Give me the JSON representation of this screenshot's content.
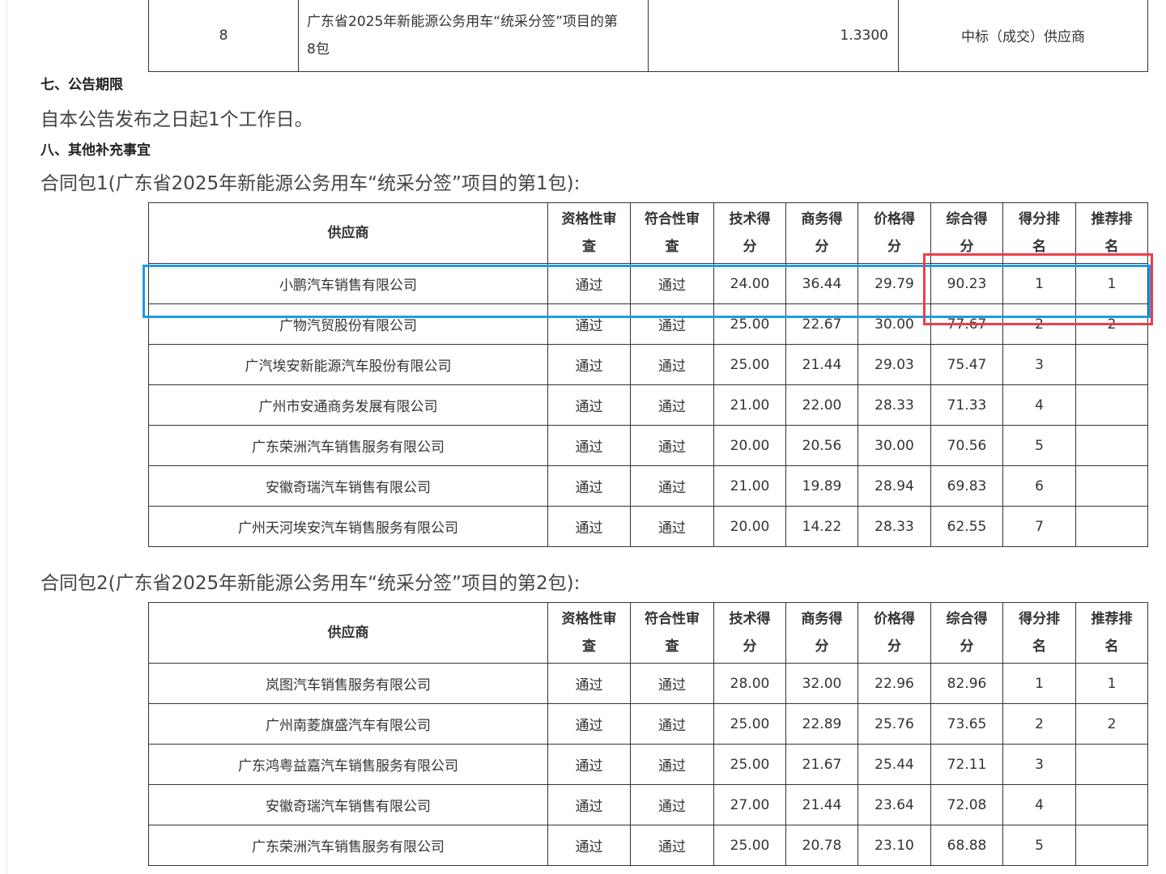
{
  "top_table": {
    "row": {
      "index": "8",
      "package_line1": "广东省2025年新能源公务用车“统采分签”项目的第",
      "package_line2": "8包",
      "amount": "1.3300",
      "result": "中标（成交）供应商"
    }
  },
  "section7": {
    "heading": "七、公告期限",
    "text": "自本公告发布之日起1个工作日。"
  },
  "section8": {
    "heading": "八、其他补充事宜"
  },
  "headers": {
    "supplier": "供应商",
    "qualification_1": "资格性审",
    "qualification_2": "查",
    "compliance_1": "符合性审",
    "compliance_2": "查",
    "tech_1": "技术得",
    "tech_2": "分",
    "business_1": "商务得",
    "business_2": "分",
    "price_1": "价格得",
    "price_2": "分",
    "total_1": "综合得",
    "total_2": "分",
    "rank_1": "得分排",
    "rank_2": "名",
    "rec_1": "推荐排",
    "rec_2": "名"
  },
  "package1": {
    "caption": "合同包1(广东省2025年新能源公务用车“统采分签”项目的第1包):",
    "rows": [
      [
        "小鹏汽车销售有限公司",
        "通过",
        "通过",
        "24.00",
        "36.44",
        "29.79",
        "90.23",
        "1",
        "1"
      ],
      [
        "广物汽贸股份有限公司",
        "通过",
        "通过",
        "25.00",
        "22.67",
        "30.00",
        "77.67",
        "2",
        "2"
      ],
      [
        "广汽埃安新能源汽车股份有限公司",
        "通过",
        "通过",
        "25.00",
        "21.44",
        "29.03",
        "75.47",
        "3",
        ""
      ],
      [
        "广州市安通商务发展有限公司",
        "通过",
        "通过",
        "21.00",
        "22.00",
        "28.33",
        "71.33",
        "4",
        ""
      ],
      [
        "广东荣洲汽车销售服务有限公司",
        "通过",
        "通过",
        "20.00",
        "20.56",
        "30.00",
        "70.56",
        "5",
        ""
      ],
      [
        "安徽奇瑞汽车销售有限公司",
        "通过",
        "通过",
        "21.00",
        "19.89",
        "28.94",
        "69.83",
        "6",
        ""
      ],
      [
        "广州天河埃安汽车销售服务有限公司",
        "通过",
        "通过",
        "20.00",
        "14.22",
        "28.33",
        "62.55",
        "7",
        ""
      ]
    ]
  },
  "package2": {
    "caption": "合同包2(广东省2025年新能源公务用车“统采分签”项目的第2包):",
    "rows": [
      [
        "岚图汽车销售服务有限公司",
        "通过",
        "通过",
        "28.00",
        "32.00",
        "22.96",
        "82.96",
        "1",
        "1"
      ],
      [
        "广州南菱旗盛汽车有限公司",
        "通过",
        "通过",
        "25.00",
        "22.89",
        "25.76",
        "73.65",
        "2",
        "2"
      ],
      [
        "广东鸿粤益嘉汽车销售服务有限公司",
        "通过",
        "通过",
        "25.00",
        "21.67",
        "25.44",
        "72.11",
        "3",
        ""
      ],
      [
        "安徽奇瑞汽车销售有限公司",
        "通过",
        "通过",
        "27.00",
        "21.44",
        "23.64",
        "72.08",
        "4",
        ""
      ],
      [
        "广东荣洲汽车销售服务有限公司",
        "通过",
        "通过",
        "25.00",
        "20.78",
        "23.10",
        "68.88",
        "5",
        ""
      ]
    ]
  },
  "colors": {
    "highlight_blue": "#1e9be6",
    "highlight_red": "#e8404a"
  }
}
